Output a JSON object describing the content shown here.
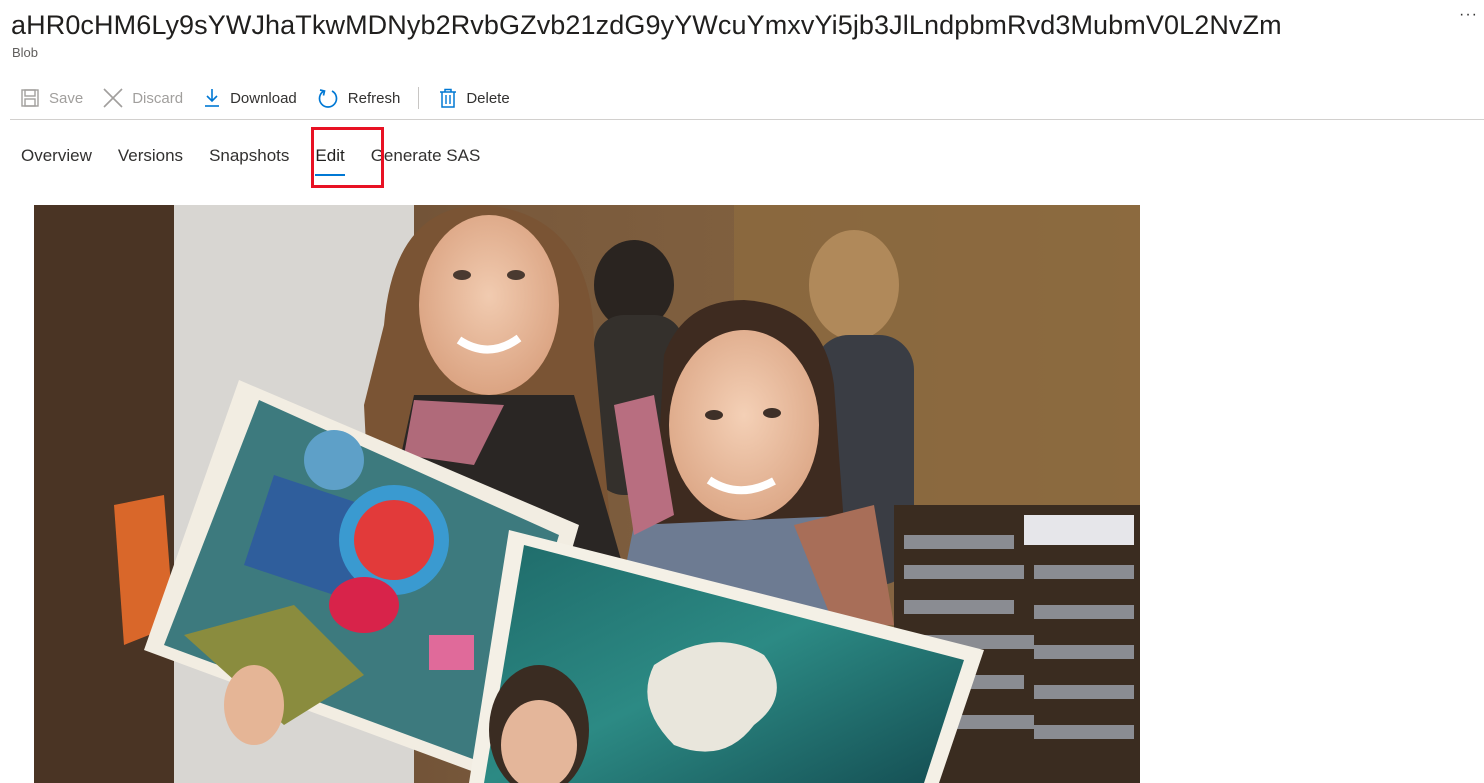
{
  "header": {
    "title": "aHR0cHM6Ly9sYWJhaTkwMDNyb2RvbGZvb21zdG9yYWcuYmxvYi5jb3JlLndpbmRvd3MubmV0L2NvZm",
    "subtitle": "Blob",
    "more_label": "···"
  },
  "toolbar": {
    "save_label": "Save",
    "discard_label": "Discard",
    "download_label": "Download",
    "refresh_label": "Refresh",
    "delete_label": "Delete"
  },
  "tabs": [
    {
      "label": "Overview",
      "active": false
    },
    {
      "label": "Versions",
      "active": false
    },
    {
      "label": "Snapshots",
      "active": false
    },
    {
      "label": "Edit",
      "active": true
    },
    {
      "label": "Generate SAS",
      "active": false
    }
  ],
  "colors": {
    "accent": "#0078d4",
    "highlight": "#e81123"
  },
  "icons": {
    "save": "save-icon",
    "discard": "close-icon",
    "download": "download-icon",
    "refresh": "refresh-icon",
    "delete": "trash-icon"
  }
}
